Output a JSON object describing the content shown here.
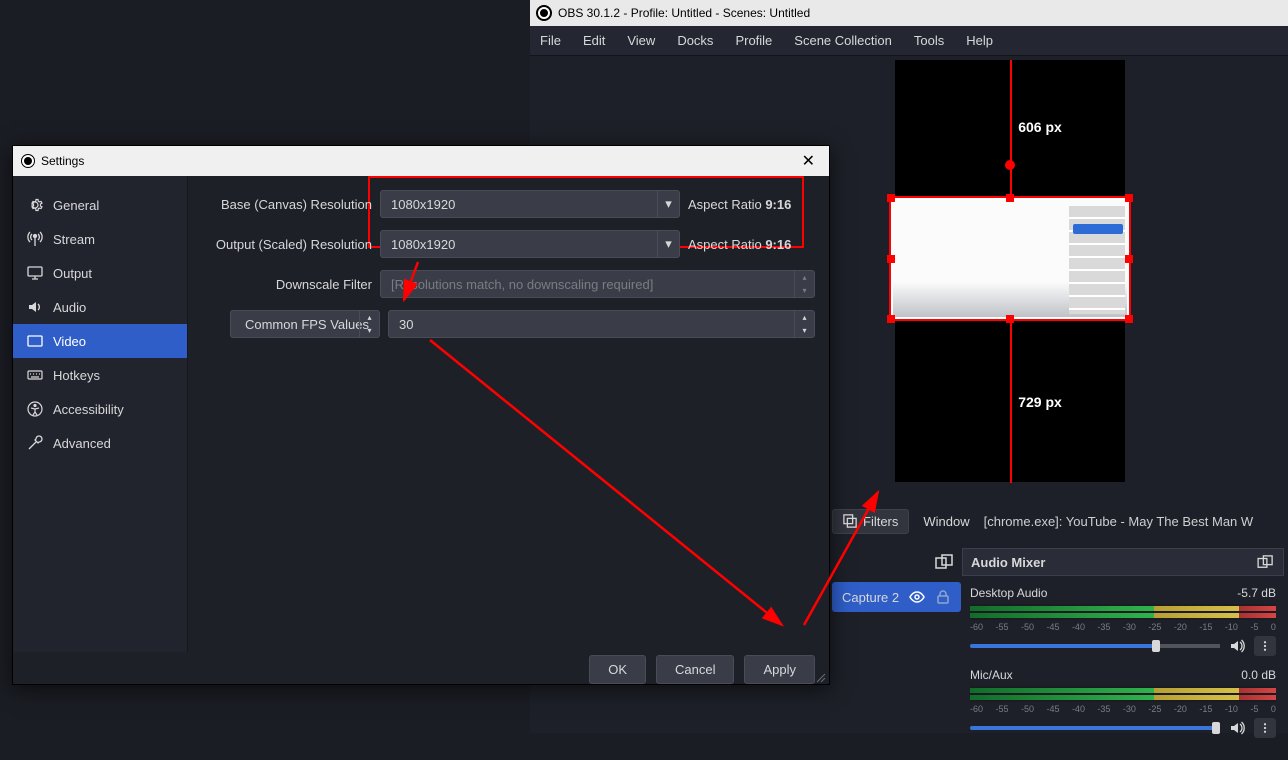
{
  "obs": {
    "title": "OBS 30.1.2 - Profile: Untitled - Scenes: Untitled",
    "menu": {
      "file": "File",
      "edit": "Edit",
      "view": "View",
      "docks": "Docks",
      "profile": "Profile",
      "scene_collection": "Scene Collection",
      "tools": "Tools",
      "help": "Help"
    }
  },
  "canvas": {
    "top_px": "606 px",
    "bot_px": "729 px"
  },
  "filters": {
    "button": "Filters",
    "window_label": "Window",
    "source": "[chrome.exe]: YouTube - May The Best Man W"
  },
  "capture": {
    "name": "Capture 2"
  },
  "audio": {
    "title": "Audio Mixer",
    "ticks": [
      "-60",
      "-55",
      "-50",
      "-45",
      "-40",
      "-35",
      "-30",
      "-25",
      "-20",
      "-15",
      "-10",
      "-5",
      "0"
    ],
    "tracks": [
      {
        "name": "Desktop Audio",
        "db": "-5.7 dB"
      },
      {
        "name": "Mic/Aux",
        "db": "0.0 dB"
      }
    ]
  },
  "settings": {
    "title": "Settings",
    "sidebar": {
      "general": "General",
      "stream": "Stream",
      "output": "Output",
      "audio": "Audio",
      "video": "Video",
      "hotkeys": "Hotkeys",
      "accessibility": "Accessibility",
      "advanced": "Advanced"
    },
    "labels": {
      "base": "Base (Canvas) Resolution",
      "output": "Output (Scaled) Resolution",
      "downscale": "Downscale Filter",
      "fps_type": "Common FPS Values",
      "aspect_prefix": "Aspect Ratio ",
      "aspect_value": "9:16"
    },
    "values": {
      "base": "1080x1920",
      "output": "1080x1920",
      "downscale": "[Resolutions match, no downscaling required]",
      "fps": "30"
    },
    "buttons": {
      "ok": "OK",
      "cancel": "Cancel",
      "apply": "Apply"
    }
  }
}
